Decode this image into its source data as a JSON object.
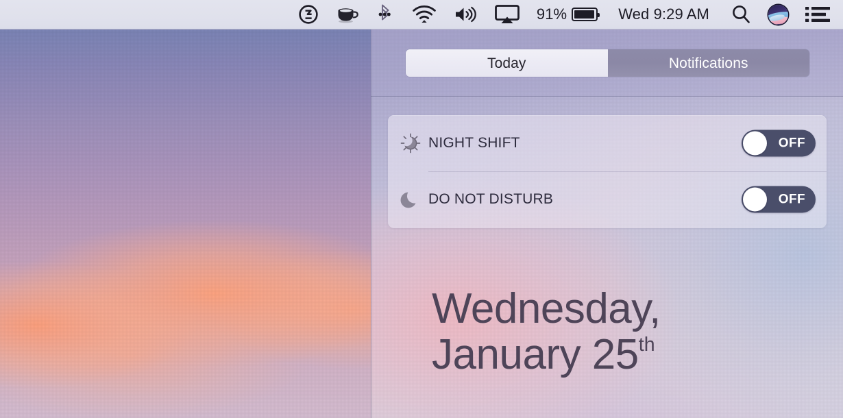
{
  "menubar": {
    "icons": [
      {
        "name": "hidden-bar-icon",
        "label": "Hidden Bar"
      },
      {
        "name": "caffeine-cup-icon",
        "label": "Caffeine"
      },
      {
        "name": "bluetooth-icon",
        "label": "Bluetooth"
      },
      {
        "name": "wifi-icon",
        "label": "Wi-Fi"
      },
      {
        "name": "volume-icon",
        "label": "Volume"
      },
      {
        "name": "airplay-icon",
        "label": "AirPlay"
      }
    ],
    "battery_percent": "91%",
    "clock": "Wed 9:29 AM",
    "search_icon": "search-icon",
    "siri_icon": "siri-icon",
    "notification_center_icon": "notification-center-icon"
  },
  "notification_center": {
    "tabs": [
      {
        "label": "Today",
        "active": false
      },
      {
        "label": "Notifications",
        "active": true
      }
    ],
    "widget": {
      "rows": [
        {
          "icon": "night-shift-icon",
          "label": "NIGHT SHIFT",
          "toggle_state": "OFF",
          "toggle_on": false
        },
        {
          "icon": "do-not-disturb-moon-icon",
          "label": "DO NOT DISTURB",
          "toggle_state": "OFF",
          "toggle_on": false
        }
      ]
    },
    "date": {
      "line1": "Wednesday,",
      "line2": "January 25",
      "ordinal": "th"
    }
  },
  "colors": {
    "menubar_bg": "#e1e2ed",
    "toggle_track": "#4a4e6a",
    "toggle_knob": "#ffffff",
    "tab_active_bg": "#8d8aa8",
    "tab_inactive_bg": "#eeedf5",
    "date_text": "#4e4458",
    "label_text": "#2c2a3c"
  }
}
